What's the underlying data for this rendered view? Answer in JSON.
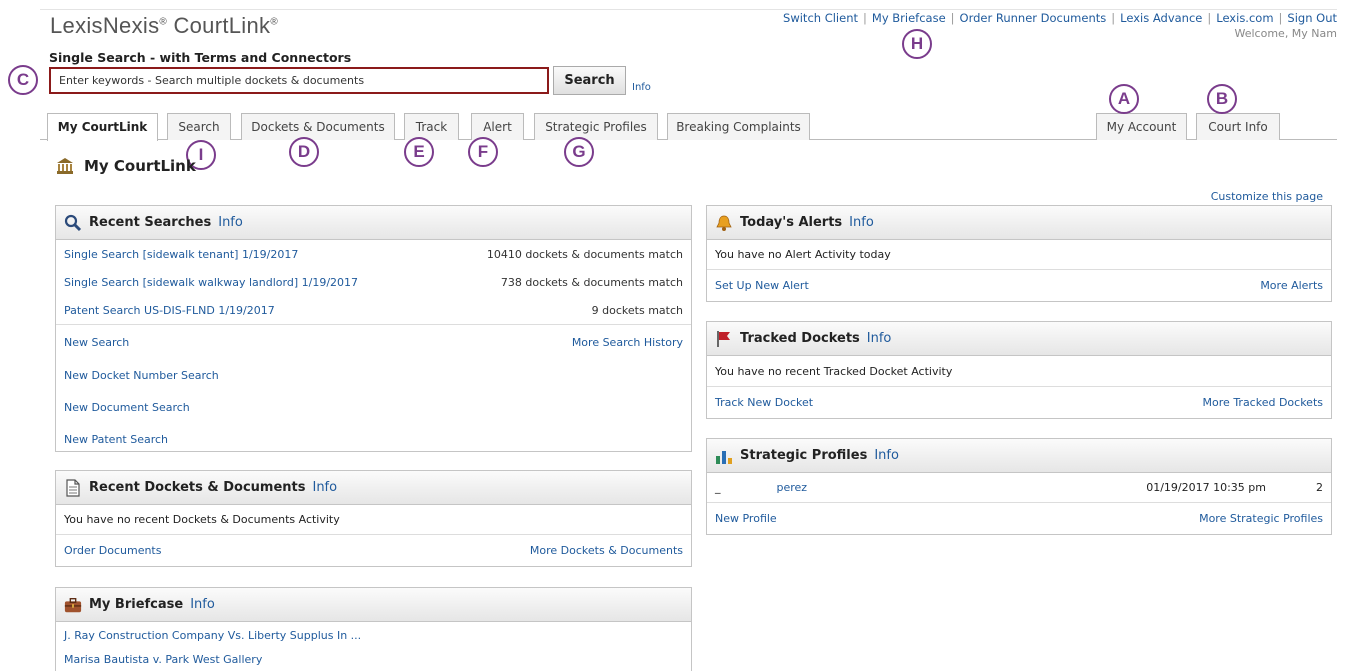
{
  "header": {
    "logo_main": "LexisNexis",
    "logo_product": " CourtLink",
    "reg": "®",
    "nav": [
      "Switch Client",
      "My Briefcase",
      "Order Runner Documents",
      "Lexis Advance",
      "Lexis.com",
      "Sign Out"
    ],
    "welcome": "Welcome, My Nam"
  },
  "search": {
    "heading": "Single Search - with Terms and Connectors",
    "placeholder": "Enter keywords - Search multiple dockets & documents",
    "button": "Search",
    "info": "Info"
  },
  "tabs": [
    "My CourtLink",
    "Search",
    "Dockets & Documents",
    "Track",
    "Alert",
    "Strategic Profiles",
    "Breaking Complaints"
  ],
  "right_tabs": [
    "My Account",
    "Court Info"
  ],
  "markers": [
    "A",
    "B",
    "C",
    "D",
    "E",
    "F",
    "G",
    "H",
    "I"
  ],
  "page_title": "My CourtLink",
  "customize": "Customize this page",
  "recent_searches": {
    "title": "Recent Searches",
    "info": "Info",
    "items": [
      {
        "label": "Single Search [sidewalk tenant] 1/19/2017",
        "count": "10410 dockets & documents match"
      },
      {
        "label": "Single Search [sidewalk walkway landlord] 1/19/2017",
        "count": "738 dockets & documents match"
      },
      {
        "label": "Patent Search US-DIS-FLND 1/19/2017",
        "count": "9 dockets match"
      }
    ],
    "new_search": "New Search",
    "more_history": "More Search History",
    "links": [
      "New Docket Number Search",
      "New Document Search",
      "New Patent Search"
    ]
  },
  "recent_dockets": {
    "title": "Recent Dockets & Documents",
    "info": "Info",
    "empty": "You have no recent Dockets & Documents Activity",
    "order": "Order Documents",
    "more": "More Dockets & Documents"
  },
  "briefcase": {
    "title": "My Briefcase",
    "info": "Info",
    "items": [
      "J. Ray Construction Company Vs. Liberty Supplus In ...",
      "Marisa Bautista v. Park West Gallery"
    ]
  },
  "alerts": {
    "title": "Today's Alerts",
    "info": "Info",
    "empty": "You have no Alert Activity today",
    "setup": "Set Up New Alert",
    "more": "More Alerts"
  },
  "tracked": {
    "title": "Tracked Dockets",
    "info": "Info",
    "empty": "You have no recent Tracked Docket Activity",
    "track": "Track New Docket",
    "more": "More Tracked Dockets"
  },
  "profiles": {
    "title": "Strategic Profiles",
    "info": "Info",
    "row_dash": "_",
    "row_name": "perez",
    "row_date": "01/19/2017 10:35 pm",
    "row_count": "2",
    "new": "New Profile",
    "more": "More Strategic Profiles"
  },
  "colors": {
    "link": "#1f5a9c",
    "search_border": "#8b1a1a",
    "marker": "#7a3c8c"
  }
}
